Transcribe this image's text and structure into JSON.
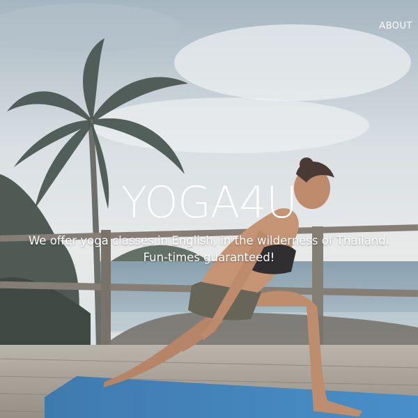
{
  "nav": {
    "about_label": "ABOUT"
  },
  "hero": {
    "title": "YOGA4U",
    "tagline_line1": "We offer yoga classes in English, in the wilderness of Thailand.",
    "tagline_line2": "Fun-times guaranteed!"
  },
  "colors": {
    "text": "#ffffff",
    "mat": "#2f79b8",
    "sky": "#c9d4da",
    "sea": "#8fa6b3"
  }
}
